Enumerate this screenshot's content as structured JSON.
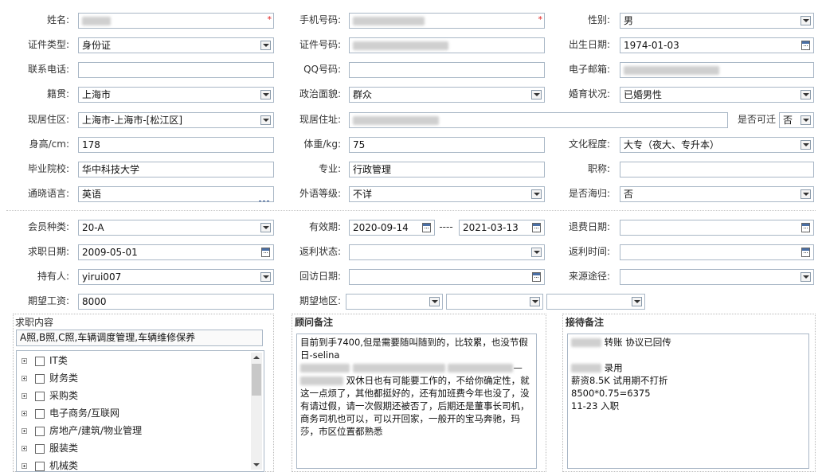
{
  "personal": {
    "name_label": "姓名:",
    "mobile_label": "手机号码:",
    "gender_label": "性别:",
    "gender_value": "男",
    "id_type_label": "证件类型:",
    "id_type_value": "身份证",
    "id_number_label": "证件号码:",
    "birth_label": "出生日期:",
    "birth_value": "1974-01-03",
    "phone_label": "联系电话:",
    "qq_label": "QQ号码:",
    "email_label": "电子邮箱:",
    "native_label": "籍贯:",
    "native_value": "上海市",
    "political_label": "政治面貌:",
    "political_value": "群众",
    "marital_label": "婚育状况:",
    "marital_value": "已婚男性",
    "residence_area_label": "现居住区:",
    "residence_area_value": "上海市-上海市-[松江区]",
    "residence_addr_label": "现居住址:",
    "relocate_label": "是否可迁",
    "relocate_value": "否",
    "height_label": "身高/cm:",
    "height_value": "178",
    "weight_label": "体重/kg:",
    "weight_value": "75",
    "education_label": "文化程度:",
    "education_value": "大专（夜大、专升本）",
    "school_label": "毕业院校:",
    "school_value": "华中科技大学",
    "major_label": "专业:",
    "major_value": "行政管理",
    "title_label": "职称:",
    "language_label": "通晓语言:",
    "language_value": "英语",
    "lang_level_label": "外语等级:",
    "lang_level_value": "不详",
    "overseas_label": "是否海归:",
    "overseas_value": "否",
    "required_mark": "*"
  },
  "membership": {
    "type_label": "会员种类:",
    "type_value": "20-A",
    "valid_label": "有效期:",
    "valid_from": "2020-09-14",
    "valid_sep": "----",
    "valid_to": "2021-03-13",
    "refund_date_label": "退费日期:",
    "job_date_label": "求职日期:",
    "job_date_value": "2009-05-01",
    "rebate_status_label": "返利状态:",
    "rebate_time_label": "返利时间:",
    "holder_label": "持有人:",
    "holder_value": "yirui007",
    "visit_date_label": "回访日期:",
    "source_label": "来源途径:",
    "salary_label": "期望工资:",
    "salary_value": "8000",
    "region_label": "期望地区:"
  },
  "job_content": {
    "title": "求职内容",
    "summary": "A照,B照,C照,车辆调度管理,车辆维修保养",
    "categories": [
      "IT类",
      "财务类",
      "采购类",
      "电子商务/互联网",
      "房地产/建筑/物业管理",
      "服装类",
      "机械类"
    ]
  },
  "consultant_notes": {
    "title": "顾问备注",
    "line1": "目前到手7400,但是需要随叫随到的，比较累，也没节假日-selina",
    "line2_suffix": "—",
    "line3": "双休日也有可能要工作的，不给你确定性，就这一点烦了，其他都挺好的，还有加班费今年也没了，没有请过假，请一次假期还被否了，后期还是董事长司机，商务司机也可以，可以开回家，一般开的宝马奔驰，玛莎，市区位置都熟悉"
  },
  "reception_notes": {
    "title": "接待备注",
    "line1": "转账 协议已回传",
    "line2": "录用",
    "line3": "薪资8.5K  试用期不打折",
    "line4": "8500*0.75=6375",
    "line5": "11-23 入职"
  }
}
